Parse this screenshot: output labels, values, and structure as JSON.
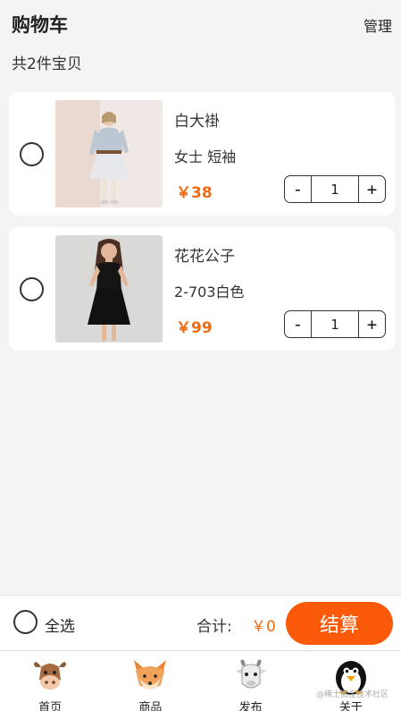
{
  "header": {
    "title": "购物车",
    "manage_label": "管理",
    "count_text": "共2件宝贝"
  },
  "items": [
    {
      "name": "白大褂",
      "desc": "女士 短袖",
      "price": "￥38",
      "minus": "-",
      "qty": "1",
      "plus": "+"
    },
    {
      "name": "花花公子",
      "desc": "2-703白色",
      "price": "￥99",
      "minus": "-",
      "qty": "1",
      "plus": "+"
    }
  ],
  "footer": {
    "select_all_label": "全选",
    "total_label": "合计:",
    "total_value": "￥0",
    "checkout_label": "结算"
  },
  "tabs": [
    {
      "label": "首页",
      "icon": "cow-icon"
    },
    {
      "label": "商品",
      "icon": "fox-icon"
    },
    {
      "label": "发布",
      "icon": "goat-icon"
    },
    {
      "label": "关于",
      "icon": "penguin-icon"
    }
  ],
  "watermark": "@稀土掘金技术社区",
  "colors": {
    "accent": "#f06a0f",
    "checkout": "#fb5a0a",
    "background": "#f4f4f4"
  }
}
